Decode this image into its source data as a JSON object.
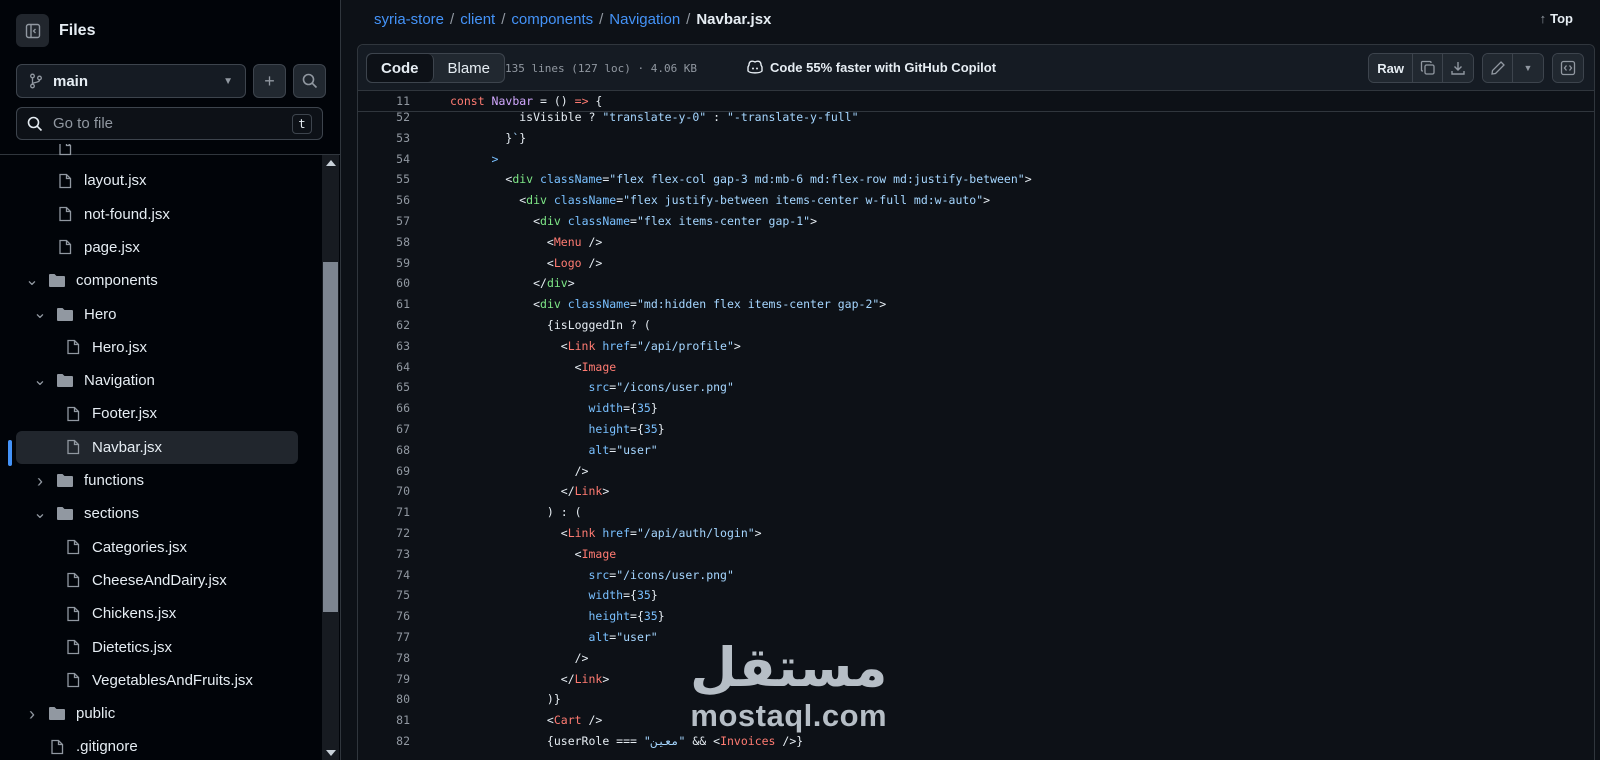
{
  "sidebar": {
    "title": "Files",
    "branch": "main",
    "goto_placeholder": "Go to file",
    "goto_shortcut": "t",
    "tree": [
      {
        "label": "",
        "type": "file",
        "depth": 1,
        "cut": true
      },
      {
        "label": "layout.jsx",
        "type": "file",
        "depth": 1
      },
      {
        "label": "not-found.jsx",
        "type": "file",
        "depth": 1
      },
      {
        "label": "page.jsx",
        "type": "file",
        "depth": 1
      },
      {
        "label": "components",
        "type": "folder",
        "depth": 0,
        "expanded": true
      },
      {
        "label": "Hero",
        "type": "folder",
        "depth": 1,
        "expanded": true
      },
      {
        "label": "Hero.jsx",
        "type": "file",
        "depth": 2
      },
      {
        "label": "Navigation",
        "type": "folder",
        "depth": 1,
        "expanded": true
      },
      {
        "label": "Footer.jsx",
        "type": "file",
        "depth": 2
      },
      {
        "label": "Navbar.jsx",
        "type": "file",
        "depth": 2,
        "active": true
      },
      {
        "label": "functions",
        "type": "folder",
        "depth": 1,
        "expanded": false
      },
      {
        "label": "sections",
        "type": "folder",
        "depth": 1,
        "expanded": true
      },
      {
        "label": "Categories.jsx",
        "type": "file",
        "depth": 2
      },
      {
        "label": "CheeseAndDairy.jsx",
        "type": "file",
        "depth": 2
      },
      {
        "label": "Chickens.jsx",
        "type": "file",
        "depth": 2
      },
      {
        "label": "Dietetics.jsx",
        "type": "file",
        "depth": 2
      },
      {
        "label": "VegetablesAndFruits.jsx",
        "type": "file",
        "depth": 2
      },
      {
        "label": "public",
        "type": "folder",
        "depth": 0,
        "expanded": false
      },
      {
        "label": ".gitignore",
        "type": "file",
        "depth": 0
      }
    ]
  },
  "breadcrumb": {
    "repo": "syria-store",
    "parts": [
      "client",
      "components",
      "Navigation"
    ],
    "current": "Navbar.jsx",
    "top_label": "Top"
  },
  "file_header": {
    "tab_code": "Code",
    "tab_blame": "Blame",
    "meta": "135 lines (127 loc) · 4.06 KB",
    "copilot": "Code 55% faster with GitHub Copilot",
    "raw": "Raw"
  },
  "code": {
    "sticky": {
      "n": "11",
      "tokens": [
        [
          "k",
          "const "
        ],
        [
          "f",
          "Navbar"
        ],
        [
          "p",
          " = () "
        ],
        [
          "k",
          "=>"
        ],
        [
          "p",
          " {"
        ]
      ]
    },
    "lines": [
      {
        "n": "52",
        "tokens": [
          [
            "p",
            "          isVisible ? "
          ],
          [
            "s",
            "\"translate-y-0\""
          ],
          [
            "p",
            " : "
          ],
          [
            "s",
            "\"-translate-y-full\""
          ]
        ]
      },
      {
        "n": "53",
        "tokens": [
          [
            "p",
            "        }"
          ],
          [
            "s",
            "`"
          ],
          [
            "p",
            "}"
          ]
        ]
      },
      {
        "n": "54",
        "tokens": [
          [
            "a",
            "      >"
          ]
        ]
      },
      {
        "n": "55",
        "tokens": [
          [
            "p",
            "        <"
          ],
          [
            "t",
            "div "
          ],
          [
            "a",
            "className"
          ],
          [
            "p",
            "="
          ],
          [
            "s",
            "\"flex flex-col gap-3 md:mb-6 md:flex-row md:justify-between\""
          ],
          [
            "p",
            ">"
          ]
        ]
      },
      {
        "n": "56",
        "tokens": [
          [
            "p",
            "          <"
          ],
          [
            "t",
            "div "
          ],
          [
            "a",
            "className"
          ],
          [
            "p",
            "="
          ],
          [
            "s",
            "\"flex justify-between items-center w-full md:w-auto\""
          ],
          [
            "p",
            ">"
          ]
        ]
      },
      {
        "n": "57",
        "tokens": [
          [
            "p",
            "            <"
          ],
          [
            "t",
            "div "
          ],
          [
            "a",
            "className"
          ],
          [
            "p",
            "="
          ],
          [
            "s",
            "\"flex items-center gap-1\""
          ],
          [
            "p",
            ">"
          ]
        ]
      },
      {
        "n": "58",
        "tokens": [
          [
            "p",
            "              <"
          ],
          [
            "k",
            "Menu"
          ],
          [
            "p",
            " />"
          ]
        ]
      },
      {
        "n": "59",
        "tokens": [
          [
            "p",
            "              <"
          ],
          [
            "k",
            "Logo"
          ],
          [
            "p",
            " />"
          ]
        ]
      },
      {
        "n": "60",
        "tokens": [
          [
            "p",
            "            </"
          ],
          [
            "t",
            "div"
          ],
          [
            "p",
            ">"
          ]
        ]
      },
      {
        "n": "61",
        "tokens": [
          [
            "p",
            "            <"
          ],
          [
            "t",
            "div "
          ],
          [
            "a",
            "className"
          ],
          [
            "p",
            "="
          ],
          [
            "s",
            "\"md:hidden flex items-center gap-2\""
          ],
          [
            "p",
            ">"
          ]
        ]
      },
      {
        "n": "62",
        "tokens": [
          [
            "p",
            "              {isLoggedIn ? ("
          ]
        ]
      },
      {
        "n": "63",
        "tokens": [
          [
            "p",
            "                <"
          ],
          [
            "k",
            "Link "
          ],
          [
            "a",
            "href"
          ],
          [
            "p",
            "="
          ],
          [
            "s",
            "\"/api/profile\""
          ],
          [
            "p",
            ">"
          ]
        ]
      },
      {
        "n": "64",
        "tokens": [
          [
            "p",
            "                  <"
          ],
          [
            "k",
            "Image"
          ]
        ]
      },
      {
        "n": "65",
        "tokens": [
          [
            "a",
            "                    src"
          ],
          [
            "p",
            "="
          ],
          [
            "s",
            "\"/icons/user.png\""
          ]
        ]
      },
      {
        "n": "66",
        "tokens": [
          [
            "a",
            "                    width"
          ],
          [
            "p",
            "={"
          ],
          [
            "a",
            "35"
          ],
          [
            "p",
            "}"
          ]
        ]
      },
      {
        "n": "67",
        "tokens": [
          [
            "a",
            "                    height"
          ],
          [
            "p",
            "={"
          ],
          [
            "a",
            "35"
          ],
          [
            "p",
            "}"
          ]
        ]
      },
      {
        "n": "68",
        "tokens": [
          [
            "a",
            "                    alt"
          ],
          [
            "p",
            "="
          ],
          [
            "s",
            "\"user\""
          ]
        ]
      },
      {
        "n": "69",
        "tokens": [
          [
            "p",
            "                  />"
          ]
        ]
      },
      {
        "n": "70",
        "tokens": [
          [
            "p",
            "                </"
          ],
          [
            "k",
            "Link"
          ],
          [
            "p",
            ">"
          ]
        ]
      },
      {
        "n": "71",
        "tokens": [
          [
            "p",
            "              ) : ("
          ]
        ]
      },
      {
        "n": "72",
        "tokens": [
          [
            "p",
            "                <"
          ],
          [
            "k",
            "Link "
          ],
          [
            "a",
            "href"
          ],
          [
            "p",
            "="
          ],
          [
            "s",
            "\"/api/auth/login\""
          ],
          [
            "p",
            ">"
          ]
        ]
      },
      {
        "n": "73",
        "tokens": [
          [
            "p",
            "                  <"
          ],
          [
            "k",
            "Image"
          ]
        ]
      },
      {
        "n": "74",
        "tokens": [
          [
            "a",
            "                    src"
          ],
          [
            "p",
            "="
          ],
          [
            "s",
            "\"/icons/user.png\""
          ]
        ]
      },
      {
        "n": "75",
        "tokens": [
          [
            "a",
            "                    width"
          ],
          [
            "p",
            "={"
          ],
          [
            "a",
            "35"
          ],
          [
            "p",
            "}"
          ]
        ]
      },
      {
        "n": "76",
        "tokens": [
          [
            "a",
            "                    height"
          ],
          [
            "p",
            "={"
          ],
          [
            "a",
            "35"
          ],
          [
            "p",
            "}"
          ]
        ]
      },
      {
        "n": "77",
        "tokens": [
          [
            "a",
            "                    alt"
          ],
          [
            "p",
            "="
          ],
          [
            "s",
            "\"user\""
          ]
        ]
      },
      {
        "n": "78",
        "tokens": [
          [
            "p",
            "                  />"
          ]
        ]
      },
      {
        "n": "79",
        "tokens": [
          [
            "p",
            "                </"
          ],
          [
            "k",
            "Link"
          ],
          [
            "p",
            ">"
          ]
        ]
      },
      {
        "n": "80",
        "tokens": [
          [
            "p",
            "              )}"
          ]
        ]
      },
      {
        "n": "81",
        "tokens": [
          [
            "p",
            "              <"
          ],
          [
            "k",
            "Cart"
          ],
          [
            "p",
            " />"
          ]
        ]
      },
      {
        "n": "82",
        "tokens": [
          [
            "p",
            "              {userRole === "
          ],
          [
            "s",
            "\"معين\""
          ],
          [
            "p",
            " && <"
          ],
          [
            "k",
            "Invoices"
          ],
          [
            "p",
            " />}"
          ]
        ]
      }
    ]
  },
  "watermark": {
    "arabic": "مستقل",
    "latin": "mostaql.com"
  },
  "colors": {
    "accent": "#4493f8",
    "background": "#0d1117",
    "sidebar": "#010409"
  }
}
